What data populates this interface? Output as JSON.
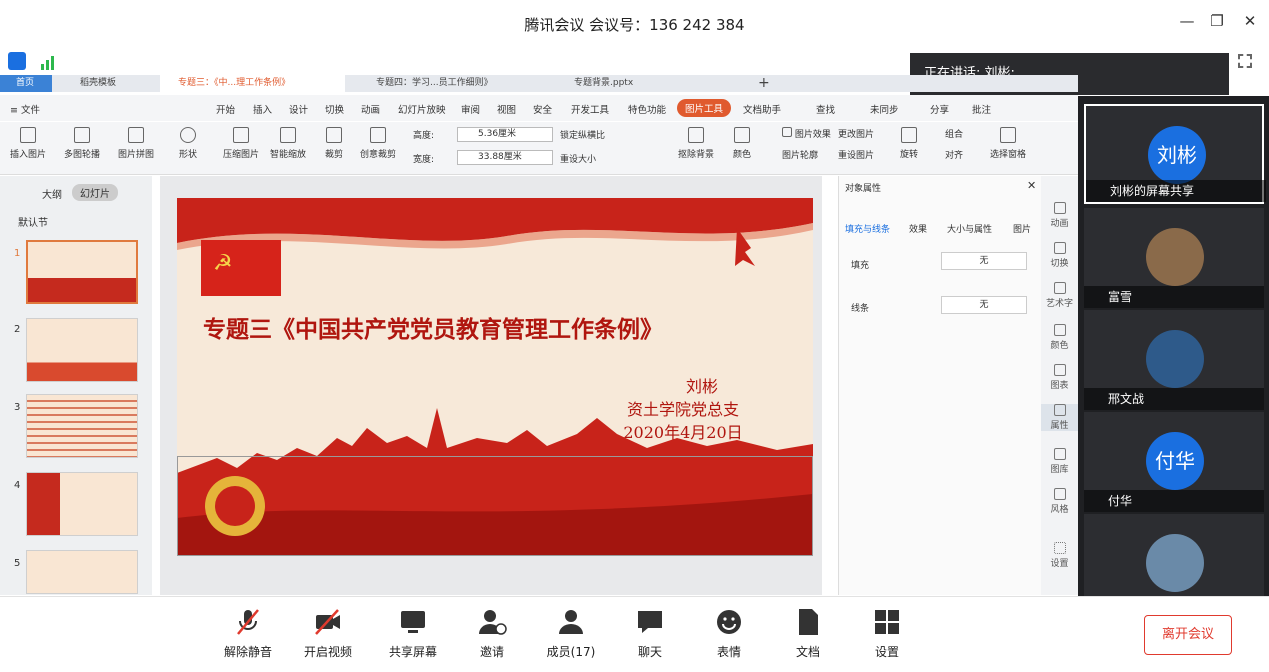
{
  "window": {
    "title": "腾讯会议 会议号：136 242 384",
    "minimize": "—",
    "restore": "❐",
    "close": "✕"
  },
  "speaking": {
    "text": "正在讲话: 刘彬;"
  },
  "tabs": [
    {
      "label": "首页"
    },
    {
      "label": "稻壳模板"
    },
    {
      "label": "专题三：《中...理工作条例》"
    },
    {
      "label": "专题四：学习...员工作细则》"
    },
    {
      "label": "专题背景.pptx"
    },
    {
      "label": "+"
    }
  ],
  "menu": [
    "≡ 文件",
    "开始",
    "插入",
    "设计",
    "切换",
    "动画",
    "幻灯片放映",
    "审阅",
    "视图",
    "安全",
    "开发工具",
    "特色功能",
    "图片工具",
    "文档助手",
    "查找",
    "未同步",
    "分享",
    "批注"
  ],
  "ribbon": {
    "items": [
      "插入图片",
      "多图轮播",
      "图片拼图",
      "形状",
      "压缩图片",
      "智能缩放",
      "裁剪",
      "创意裁剪",
      "旋转",
      "对齐",
      "选择窗格",
      "抠除背景",
      "颜色",
      "图片效果",
      "重设图片",
      "更改图片",
      "图片轮廓",
      "组合"
    ],
    "height_label": "高度:",
    "height_value": "5.36厘米",
    "width_label": "宽度:",
    "width_value": "33.88厘米",
    "lock_ratio": "锁定纵横比",
    "reset_size": "重设大小"
  },
  "slides_panel": {
    "outline_label": "大纲",
    "slides_label": "幻灯片",
    "section": "默认节",
    "numbers": [
      "1",
      "2",
      "3",
      "4",
      "5"
    ]
  },
  "slide": {
    "title": "专题三《中国共产党党员教育管理工作条例》",
    "author": "刘彬",
    "org": "资土学院党总支",
    "date": "2020年4月20日"
  },
  "props": {
    "header": "对象属性",
    "tabs": [
      "填充与线条",
      "效果",
      "大小与属性",
      "图片"
    ],
    "fill_label": "填充",
    "fill_value": "无",
    "line_label": "线条",
    "line_value": "无"
  },
  "sidebar": [
    "动画",
    "切换",
    "艺术字",
    "颜色",
    "图表",
    "属性",
    "图库",
    "风格",
    "设置"
  ],
  "participants": [
    {
      "name": "刘彬的屏幕共享",
      "avatar_text": "刘彬",
      "color": "#1a6fe0"
    },
    {
      "name": "富雪",
      "avatar_text": "",
      "color": "#8a6a4a"
    },
    {
      "name": "邢文战",
      "avatar_text": "",
      "color": "#2e5a8a"
    },
    {
      "name": "付华",
      "avatar_text": "付华",
      "color": "#1a6fe0"
    },
    {
      "name": "",
      "avatar_text": "",
      "color": "#6a8aa8"
    }
  ],
  "bottom": {
    "buttons": [
      "解除静音",
      "开启视频",
      "共享屏幕",
      "邀请",
      "成员(17)",
      "聊天",
      "表情",
      "文档",
      "设置"
    ],
    "leave": "离开会议"
  }
}
